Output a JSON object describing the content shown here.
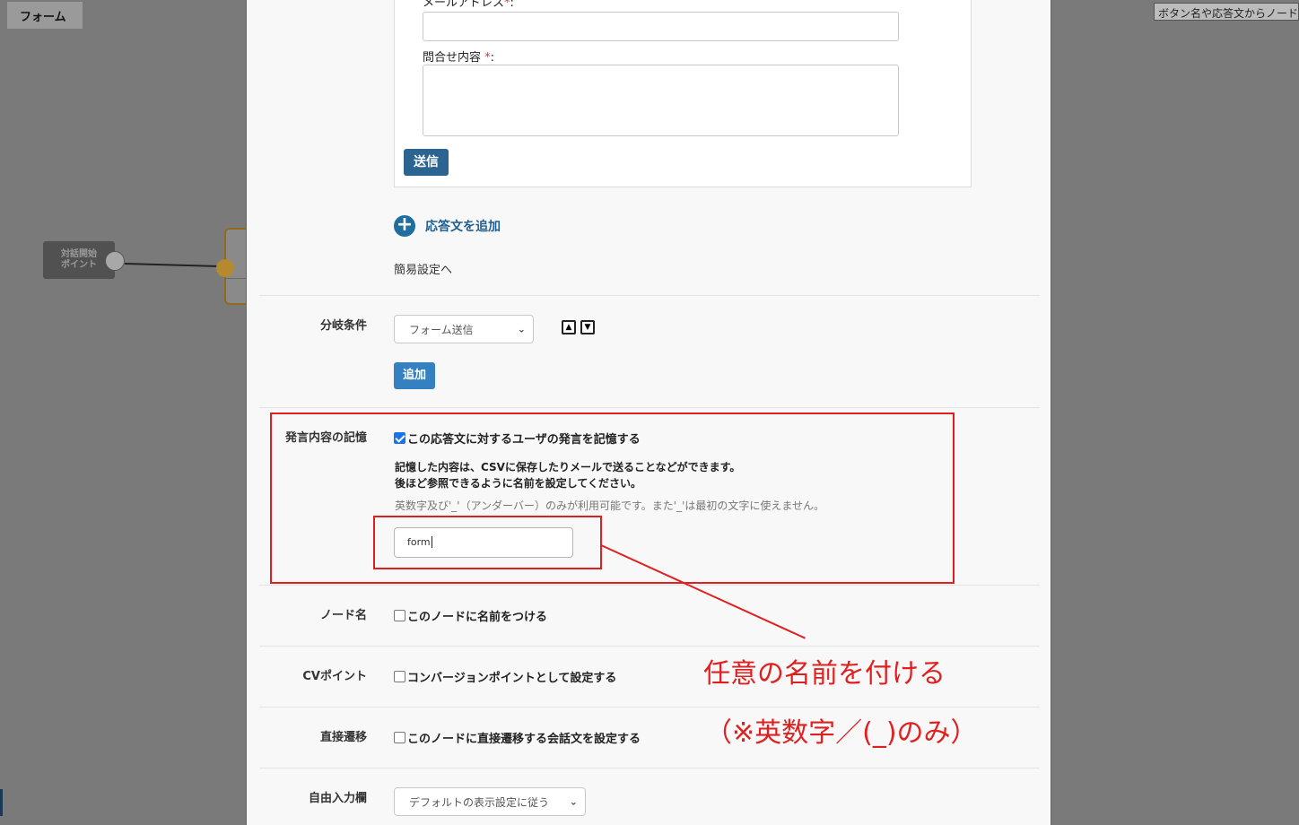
{
  "background": {
    "title": "フォーム",
    "search_placeholder": "ボタン名や応答文からノード",
    "start_node": {
      "line1": "対話開始",
      "line2": "ポイント"
    }
  },
  "form_preview": {
    "email_label": "メールアドレス",
    "inquiry_label": "問合せ内容",
    "required_mark": "*",
    "colon": ":",
    "send_button": "送信"
  },
  "add_answer": {
    "icon": "plus-circle-icon",
    "label": "応答文を追加"
  },
  "simple_settings_link": "簡易設定へ",
  "branch": {
    "label": "分岐条件",
    "selected": "フォーム送信",
    "up_arrow": "▲",
    "down_arrow": "▼",
    "add_button": "追加"
  },
  "memory": {
    "label": "発言内容の記憶",
    "checkbox_label": "この応答文に対するユーザの発言を記憶する",
    "checked": true,
    "desc_line1": "記憶した内容は、CSVに保存したりメールで送ることなどができます。",
    "desc_line2": "後ほど参照できるように名前を設定してください。",
    "note": "英数字及び'_'（アンダーバー）のみが利用可能です。また'_'は最初の文字に使えません。",
    "input_value": "form"
  },
  "node_name": {
    "label": "ノード名",
    "checkbox_label": "このノードに名前をつける"
  },
  "cv_point": {
    "label": "CVポイント",
    "checkbox_label": "コンバージョンポイントとして設定する"
  },
  "direct": {
    "label": "直接遷移",
    "checkbox_label": "このノードに直接遷移する会話文を設定する"
  },
  "free_input": {
    "label": "自由入力欄",
    "selected": "デフォルトの表示設定に従う"
  },
  "annotation": {
    "line1": "任意の名前を付ける",
    "line2": "（※英数字／(_)のみ）",
    "color": "#e02020"
  }
}
